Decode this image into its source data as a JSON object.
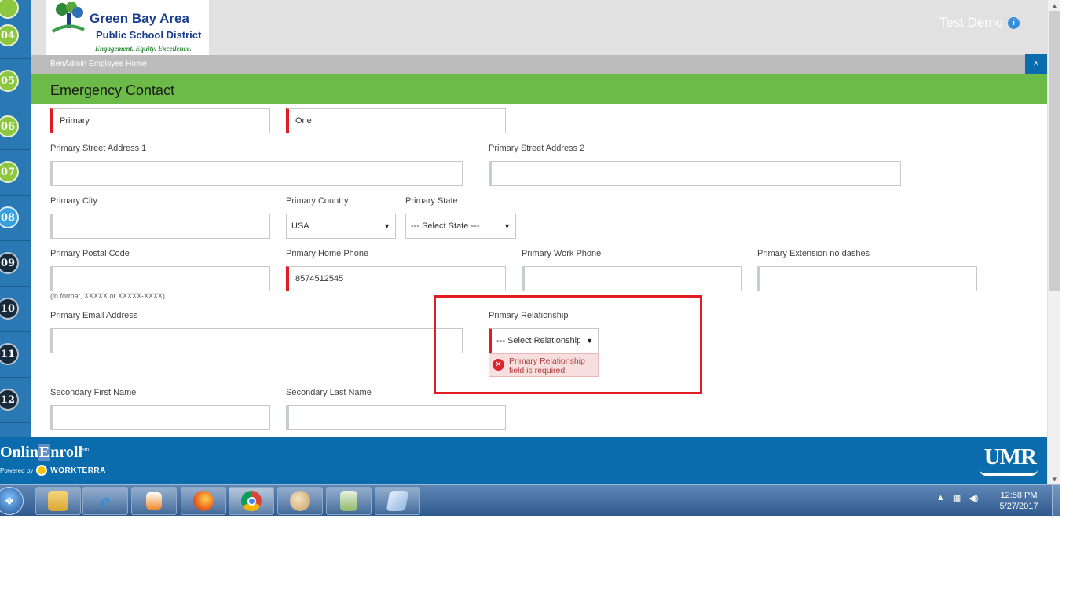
{
  "steps": [
    {
      "number": "04",
      "state": "done"
    },
    {
      "number": "05",
      "state": "done"
    },
    {
      "number": "06",
      "state": "done"
    },
    {
      "number": "07",
      "state": "done"
    },
    {
      "number": "08",
      "state": "active"
    },
    {
      "number": "09",
      "state": "todo"
    },
    {
      "number": "10",
      "state": "todo"
    },
    {
      "number": "11",
      "state": "todo"
    },
    {
      "number": "12",
      "state": "todo"
    }
  ],
  "header": {
    "logo_line1": "Green Bay Area",
    "logo_line2": "Public School District",
    "logo_tagline": "Engagement. Equity. Excellence.",
    "user_name": "Test Demo",
    "info_icon": "i"
  },
  "breadcrumb": "BenAdmin Employee Home",
  "collapse_icon": "˄",
  "section_title": "Emergency Contact",
  "form": {
    "first_name_value": "Primary",
    "last_name_value": "One",
    "street1_label": "Primary Street Address 1",
    "street1_value": "",
    "street2_label": "Primary Street Address 2",
    "street2_value": "",
    "city_label": "Primary City",
    "city_value": "",
    "country_label": "Primary Country",
    "country_value": "USA",
    "state_label": "Primary State",
    "state_value": "--- Select State ---",
    "postal_label": "Primary Postal Code",
    "postal_value": "",
    "postal_hint": "(in format, XXXXX or XXXXX-XXXX)",
    "home_phone_label": "Primary Home Phone",
    "home_phone_value": "8574512545",
    "work_phone_label": "Primary Work Phone",
    "work_phone_value": "",
    "extension_label": "Primary Extension no dashes",
    "extension_value": "",
    "email_label": "Primary Email Address",
    "email_value": "",
    "relationship_label": "Primary Relationship",
    "relationship_value": "--- Select Relationship",
    "relationship_error": "Primary Relationship field is required.",
    "secondary_first_label": "Secondary First Name",
    "secondary_first_value": "",
    "secondary_last_label": "Secondary Last Name",
    "secondary_last_value": ""
  },
  "caret": "▼",
  "error_icon": "✕",
  "footer": {
    "brand_part1": "Onlin",
    "brand_part2": "E",
    "brand_part3": "nroll",
    "brand_mark": "sm",
    "powered_by": "Powered by",
    "powered_brand": "WORKTERRA",
    "right_logo": "UMR"
  },
  "taskbar": {
    "apps": [
      "Windows Explorer",
      "Internet Explorer",
      "Media Player",
      "Firefox",
      "Chrome",
      "Paint",
      "Calculator",
      "Notepad"
    ],
    "time": "12:58 PM",
    "date": "5/27/2017"
  },
  "colors": {
    "section_green": "#6cbb48",
    "footer_blue": "#0a6cad",
    "required_red": "#e21c23"
  }
}
